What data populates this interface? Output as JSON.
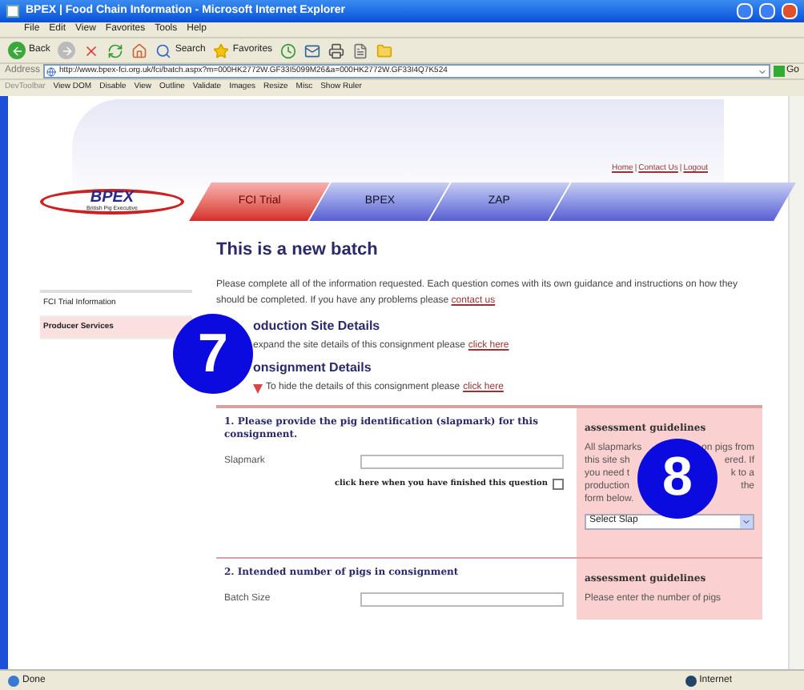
{
  "window": {
    "title": "BPEX | Food Chain Information - Microsoft Internet Explorer"
  },
  "menu": [
    "File",
    "Edit",
    "View",
    "Favorites",
    "Tools",
    "Help"
  ],
  "toolbar": {
    "back": "Back",
    "search": "Search",
    "favorites": "Favorites"
  },
  "address": {
    "label": "Address",
    "url": "http://www.bpex-fci.org.uk/fci/batch.aspx?m=000HK2772W.GF33I5099M26&a=000HK2772W.GF33I4Q7K524",
    "go": "Go"
  },
  "dev_toolbar": [
    "DevToolbar",
    "View DOM",
    "Disable",
    "View",
    "Outline",
    "Validate",
    "Images",
    "Resize",
    "Misc",
    "Show Ruler"
  ],
  "top_links": {
    "items": [
      "Home",
      "Contact Us",
      "Logout"
    ],
    "separator": "|"
  },
  "logo": {
    "name": "BPEX",
    "tagline": "British Pig Executive"
  },
  "tabs": [
    {
      "label": "FCI Trial",
      "selected": true
    },
    {
      "label": "BPEX",
      "selected": false
    },
    {
      "label": "ZAP",
      "selected": false
    }
  ],
  "sidebar": {
    "items": [
      {
        "label": "FCI Trial Information",
        "selected": false
      },
      {
        "label": "Producer Services",
        "selected": true
      }
    ]
  },
  "heading": "This is a new batch",
  "intro": {
    "text": "Please complete all of the information requested. Each question comes with its own guidance and instructions on how they should be completed. If you have any problems please",
    "link": "contact us"
  },
  "callouts": [
    "7",
    "8"
  ],
  "sections": [
    {
      "title": "oduction Site Details",
      "expanded": false,
      "text": "expand the site details of this consignment please",
      "link": "click here"
    },
    {
      "title": "onsignment Details",
      "expanded": true,
      "text": "To hide the details of this consignment please",
      "link": "click here"
    }
  ],
  "questions": [
    {
      "title": "1. Please provide the pig identification (slapmark) for this consignment.",
      "field_label": "Slapmark",
      "confirm": "click here when you have finished this question",
      "checked": false,
      "guidelines": {
        "heading": "assessment guidelines",
        "left_lines": [
          "All slapmarks",
          "this site sh",
          "you need t",
          "production",
          "form below."
        ],
        "right_lines": [
          "on pigs from",
          "ered. If",
          "k to a",
          "the"
        ],
        "select": "Select Slap"
      }
    },
    {
      "title": "2. Intended number of pigs in consignment",
      "field_label": "Batch Size",
      "guidelines": {
        "heading": "assessment guidelines",
        "left_lines": [
          "Please enter the number of pigs"
        ]
      }
    }
  ],
  "status_bar": {
    "text": "Done",
    "zone": "Internet"
  }
}
